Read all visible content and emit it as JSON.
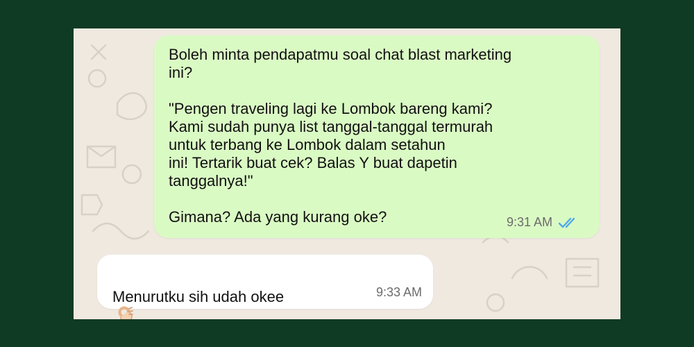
{
  "colors": {
    "page_background": "#0f3a24",
    "chat_background": "#efe9e0",
    "outgoing_bubble": "#dafac4",
    "incoming_bubble": "#ffffff",
    "read_receipt": "#4fa8e8"
  },
  "messages": {
    "outgoing": {
      "text": "Boleh minta pendapatmu soal chat blast marketing\nini?\n\n\"Pengen traveling lagi ke Lombok bareng kami?\nKami sudah punya list tanggal-tanggal termurah\nuntuk terbang ke Lombok dalam setahun\nini! Tertarik buat cek? Balas Y buat dapetin\ntanggalnya!\"\n\nGimana? Ada yang kurang oke?",
      "time": "9:31 AM",
      "status_icon": "double-check-read-icon"
    },
    "incoming": {
      "text": "Menurutku sih udah okee",
      "emoji": "ok-hand-icon",
      "time": "9:33 AM"
    }
  }
}
